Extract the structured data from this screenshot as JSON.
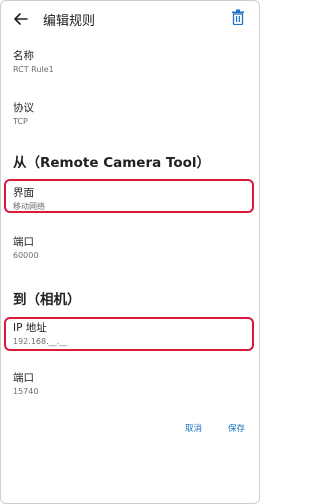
{
  "header": {
    "title": "编辑规则"
  },
  "fields": {
    "name": {
      "label": "名称",
      "value": "RCT Rule1"
    },
    "protocol": {
      "label": "协议",
      "value": "TCP"
    }
  },
  "from_section": {
    "title": "从（Remote Camera Tool）",
    "interface": {
      "label": "界面",
      "value": "移动网络"
    },
    "port": {
      "label": "端口",
      "value": "60000"
    }
  },
  "to_section": {
    "title": "到（相机）",
    "ip": {
      "label": "IP 地址",
      "value": "192.168.__.__"
    },
    "port": {
      "label": "端口",
      "value": "15740"
    }
  },
  "actions": {
    "cancel": "取消",
    "save": "保存"
  },
  "icons": {
    "back": "back-arrow-icon",
    "delete": "trash-icon"
  },
  "colors": {
    "highlight": "#d81b3a",
    "accent": "#1e73c8"
  }
}
